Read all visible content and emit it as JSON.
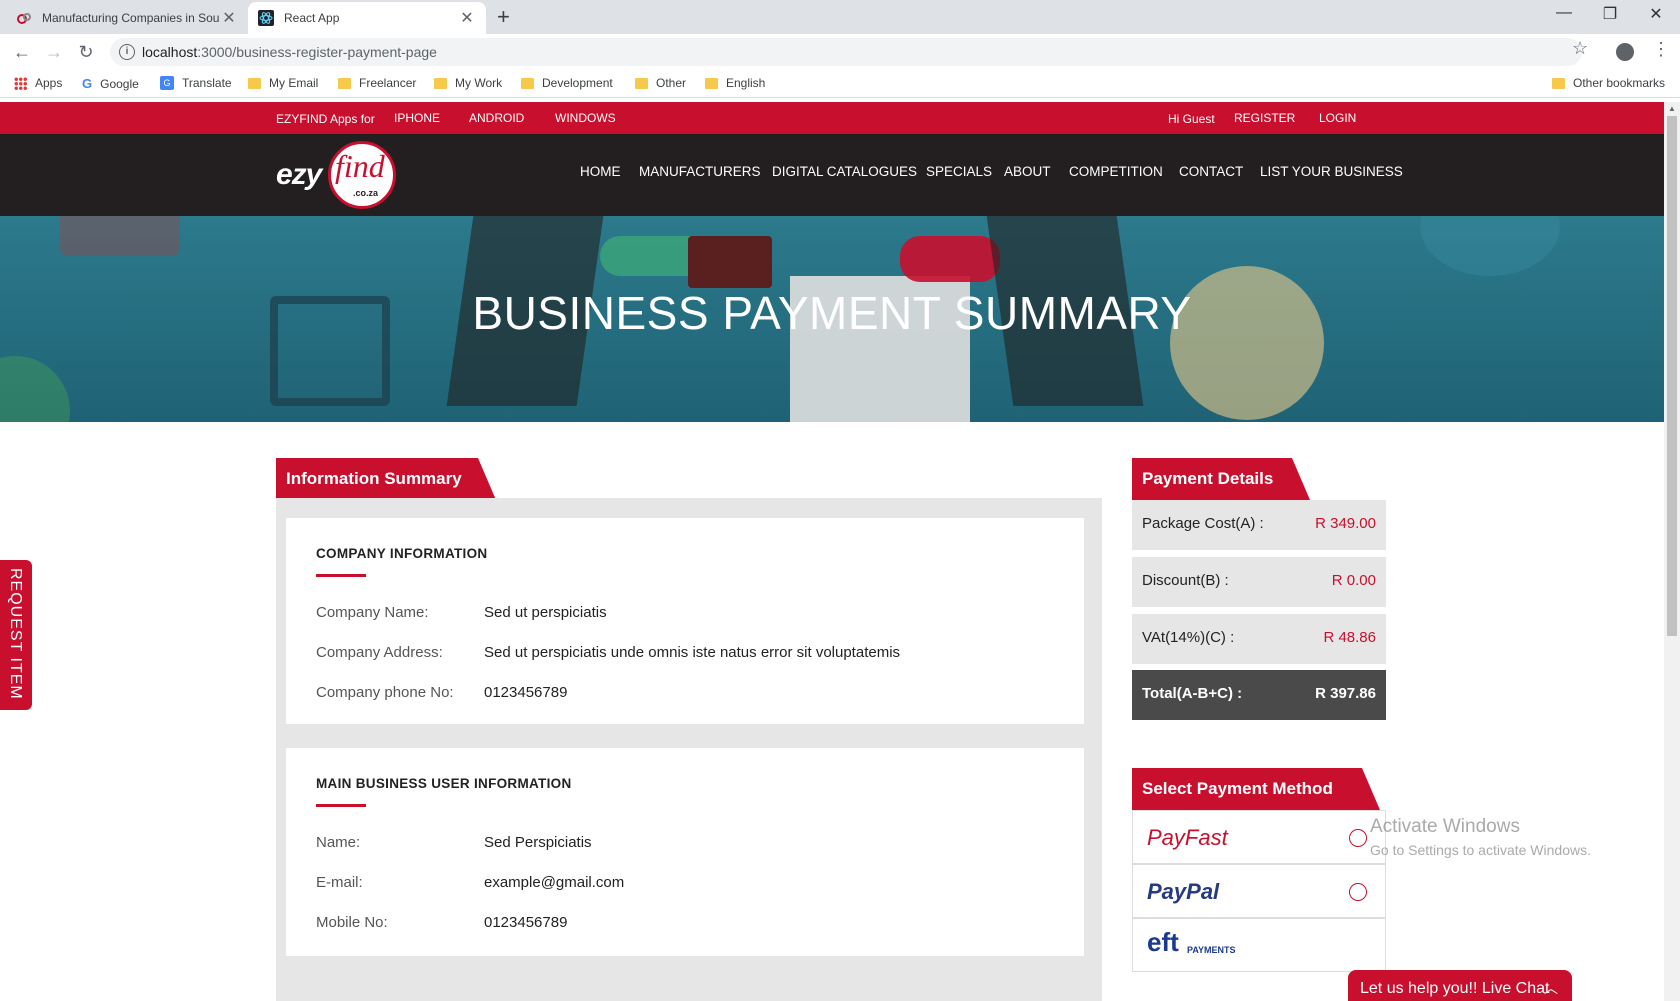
{
  "browser": {
    "tabs": [
      {
        "title": "Manufacturing Companies in Sou",
        "active": false
      },
      {
        "title": "React App",
        "active": true
      }
    ],
    "url_host": "localhost",
    "url_path": ":3000/business-register-payment-page",
    "bookmarks": [
      "Apps",
      "Google",
      "Translate",
      "My Email",
      "Freelancer",
      "My Work",
      "Development",
      "Other",
      "English"
    ],
    "other_bookmarks": "Other bookmarks"
  },
  "topbar": {
    "apps_for": "EZYFIND Apps for",
    "platforms": [
      "IPHONE",
      "ANDROID",
      "WINDOWS"
    ],
    "greeting": "Hi Guest",
    "register": "REGISTER",
    "login": "LOGIN"
  },
  "logo": {
    "ezy": "ezy",
    "find": "find",
    "coza": ".co.za"
  },
  "nav": [
    "HOME",
    "MANUFACTURERS",
    "DIGITAL CATALOGUES",
    "SPECIALS",
    "ABOUT",
    "COMPETITION",
    "CONTACT",
    "LIST YOUR BUSINESS"
  ],
  "hero": {
    "title": "BUSINESS PAYMENT SUMMARY"
  },
  "info_summary": {
    "heading": "Information Summary",
    "company": {
      "title": "COMPANY INFORMATION",
      "rows": [
        {
          "label": "Company Name:",
          "value": "Sed ut perspiciatis"
        },
        {
          "label": "Company Address:",
          "value": "Sed ut perspiciatis unde omnis iste natus error sit voluptatemis"
        },
        {
          "label": "Company phone No:",
          "value": "0123456789"
        }
      ]
    },
    "user": {
      "title": "MAIN BUSINESS USER INFORMATION",
      "rows": [
        {
          "label": "Name:",
          "value": "Sed Perspiciatis"
        },
        {
          "label": "E-mail:",
          "value": "example@gmail.com"
        },
        {
          "label": "Mobile No:",
          "value": "0123456789"
        }
      ]
    }
  },
  "payment_details": {
    "heading": "Payment Details",
    "rows": [
      {
        "label": "Package Cost(A) :",
        "value": "R 349.00"
      },
      {
        "label": "Discount(B) :",
        "value": "R 0.00"
      },
      {
        "label": "VAt(14%)(C) :",
        "value": "R 48.86"
      },
      {
        "label": "Total(A-B+C) :",
        "value": "R 397.86"
      }
    ]
  },
  "payment_method": {
    "heading": "Select Payment Method",
    "options": [
      "PayFast",
      "PayPal",
      "eft"
    ],
    "eft_sub": "PAYMENTS"
  },
  "request_item": "REQUEST ITEM",
  "activate_windows": {
    "line1": "Activate Windows",
    "line2": "Go to Settings to activate Windows."
  },
  "live_chat": "Let us help you!! Live Chat",
  "colors": {
    "brand_red": "#c8102e",
    "nav_dark": "#231f20",
    "hero_teal": "#2c7a8c"
  }
}
